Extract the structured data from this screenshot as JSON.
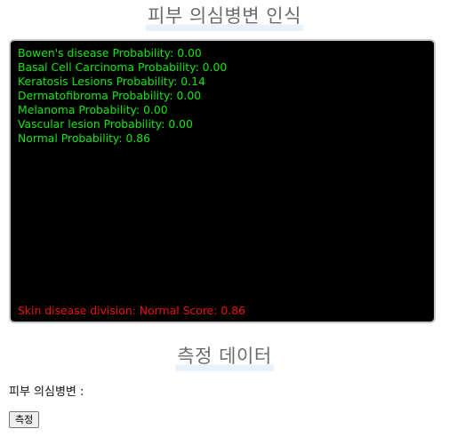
{
  "header": {
    "title": "피부 의심병변 인식"
  },
  "camera_view": {
    "probabilities": [
      "Bowen's disease Probability: 0.00",
      "Basal Cell Carcinoma Probability: 0.00",
      "Keratosis Lesions Probability: 0.14",
      "Dermatofibroma Probability: 0.00",
      "Melanoma Probability: 0.00",
      "Vascular lesion Probability: 0.00",
      "Normal Probability: 0.86"
    ],
    "division_text": "Skin disease division: Normal Score: 0.86",
    "colors": {
      "background": "#000000",
      "probability_text": "#13e613",
      "division_text": "#e81010"
    }
  },
  "measurement": {
    "title": "측정 데이터",
    "label": "피부 의심병변 :",
    "button_label": "측정"
  }
}
